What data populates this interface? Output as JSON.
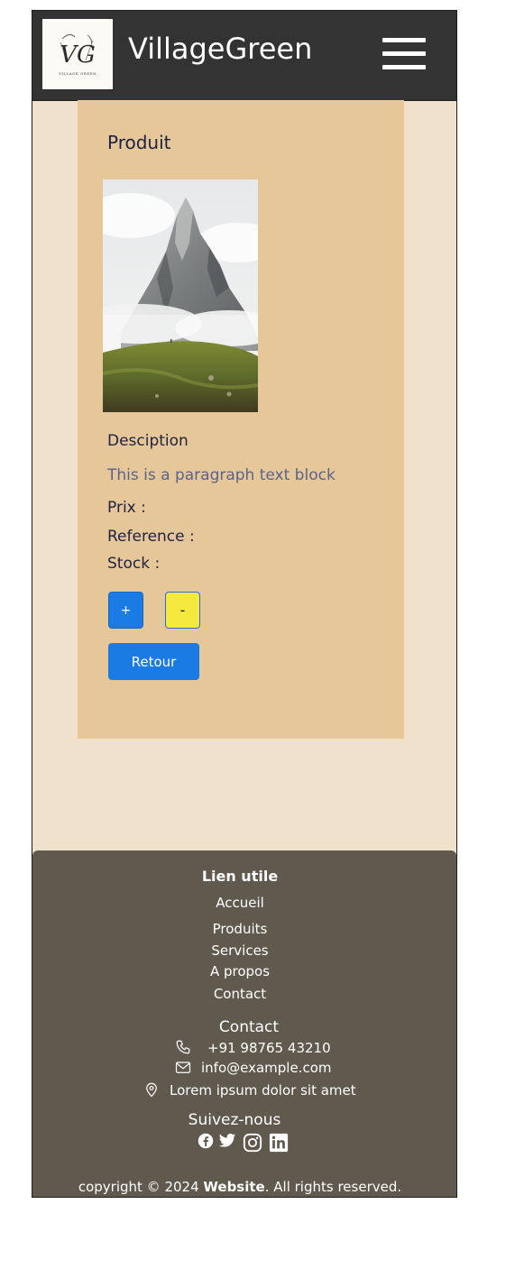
{
  "header": {
    "logo_text": "VG",
    "logo_caption": "VILLAGE GREEN",
    "brand": "VillageGreen"
  },
  "product": {
    "title": "Produit",
    "description_label": "Desciption",
    "description_text": "This is a paragraph text block",
    "price_label": "Prix :",
    "reference_label": "Reference :",
    "stock_label": "Stock :",
    "plus_label": "+",
    "minus_label": "-",
    "back_label": "Retour"
  },
  "footer": {
    "links_heading": "Lien utile",
    "links": [
      "Accueil",
      "Produits",
      "Services",
      "A propos",
      "Contact"
    ],
    "contact_heading": "Contact",
    "phone": "+91 98765 43210",
    "email": "info@example.com",
    "address": "Lorem ipsum dolor sit amet",
    "social_heading": "Suivez-nous",
    "social_icons": [
      "facebook-icon",
      "twitter-icon",
      "instagram-icon",
      "linkedin-icon"
    ],
    "copyright_prefix": "copyright © 2024 ",
    "copyright_site": "Website",
    "copyright_suffix": ". All rights reserved."
  },
  "colors": {
    "header_bg": "#333333",
    "page_bg": "#efe1cc",
    "card_bg": "#e6c799",
    "footer_bg": "#5f594e",
    "primary_button": "#1a7be5",
    "minus_button": "#f5e93f",
    "heading_text": "#1e2140",
    "paragraph_text": "#5b6487"
  }
}
